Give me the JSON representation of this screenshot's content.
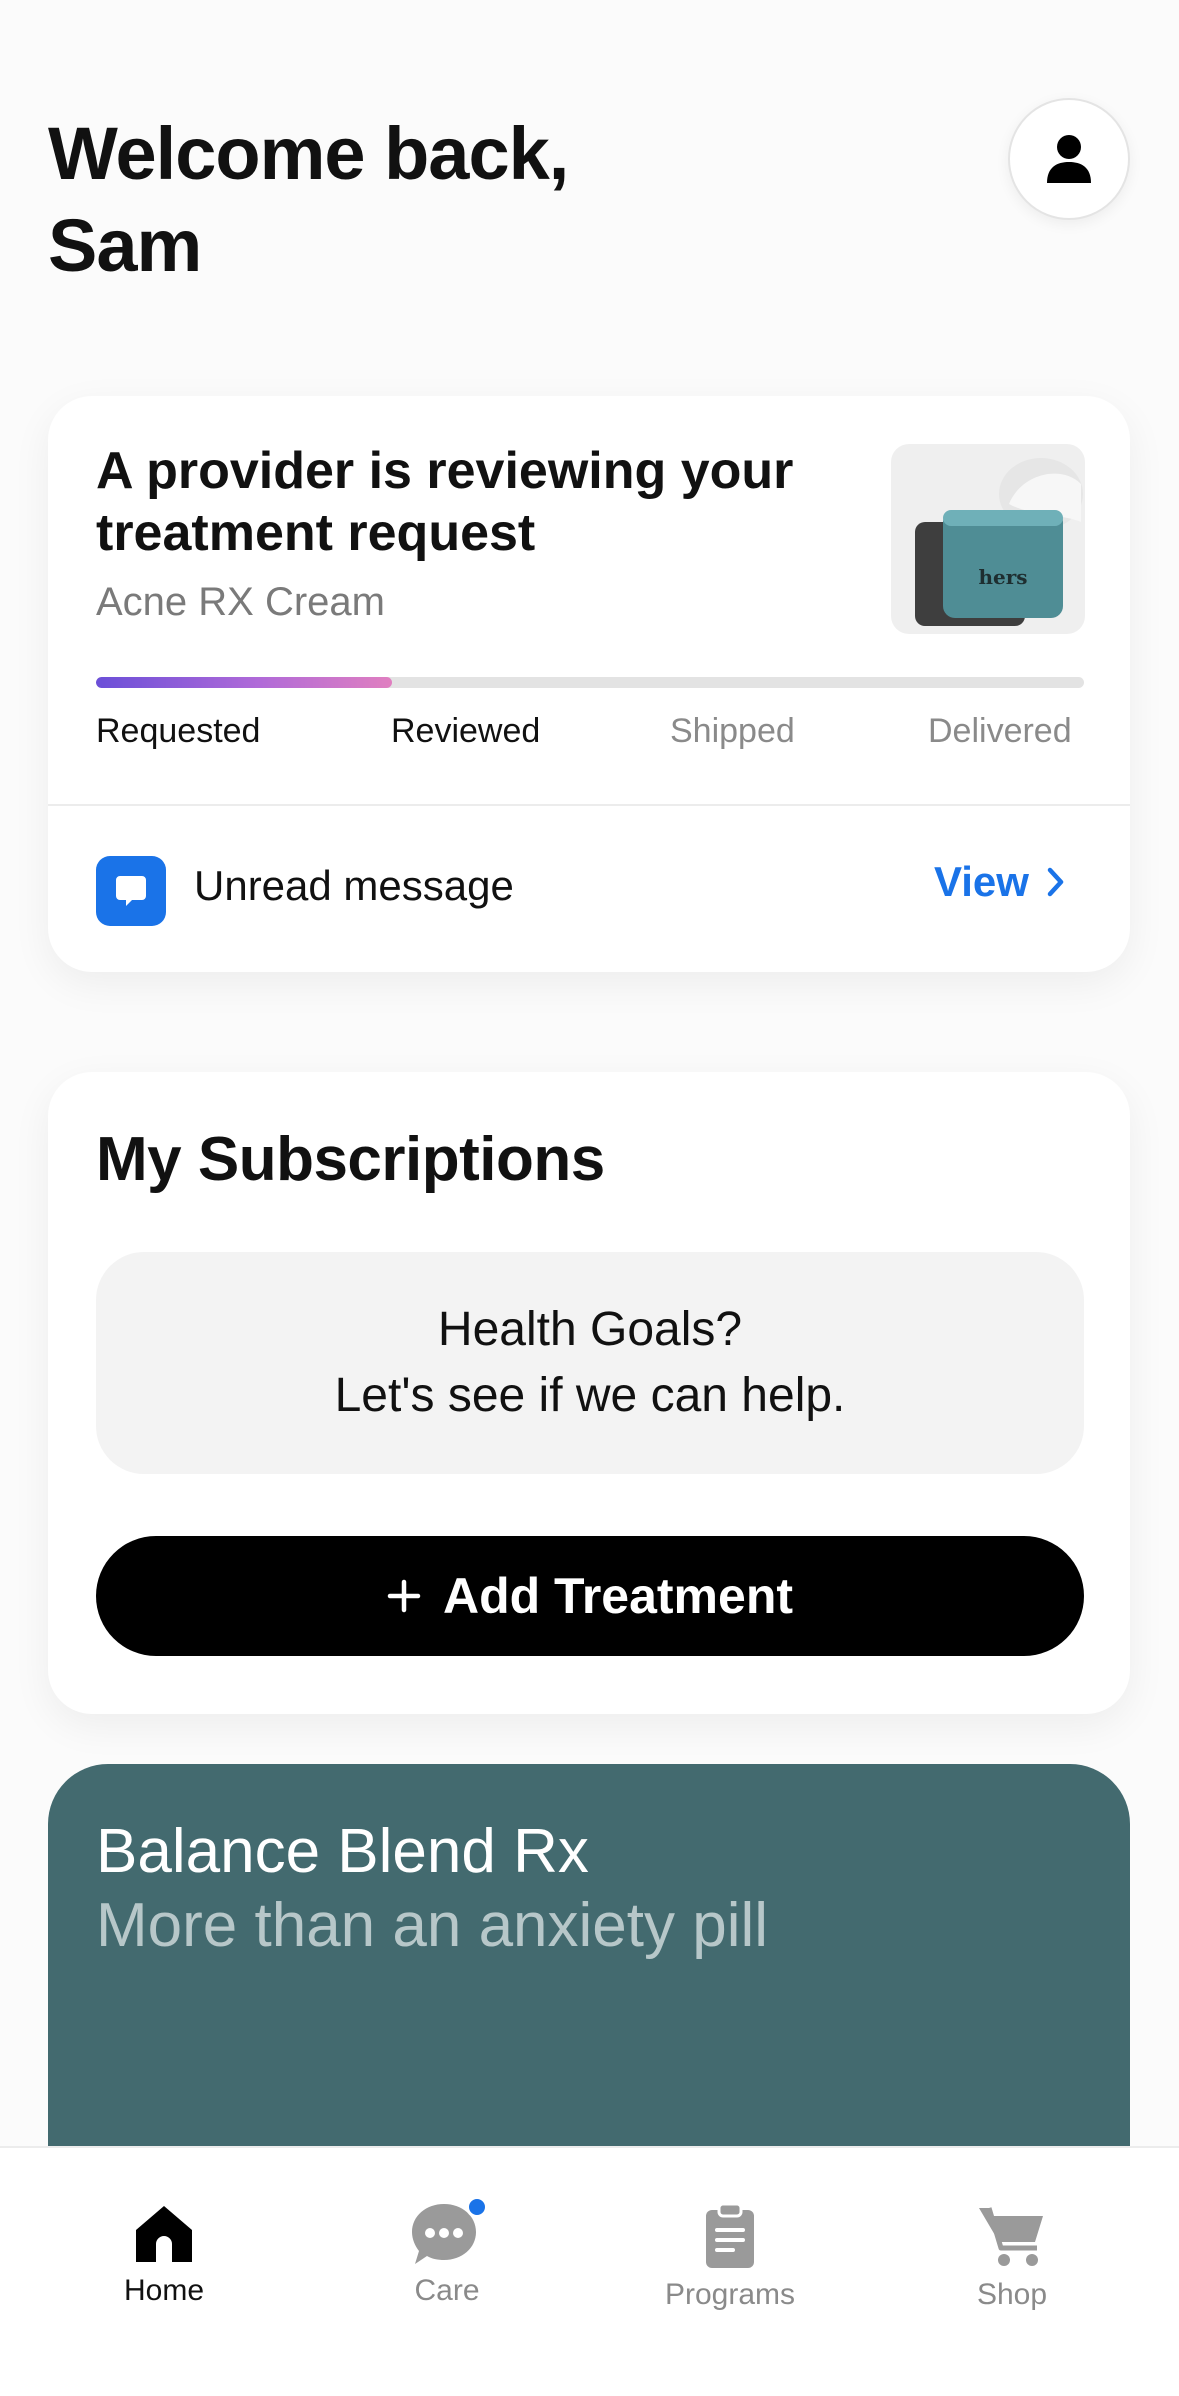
{
  "header": {
    "greeting_line1": "Welcome back,",
    "greeting_line2": "Sam"
  },
  "status_card": {
    "title": "A provider is reviewing your treatment request",
    "product": "Acne RX Cream",
    "product_image_brand": "hers",
    "progress_percent": 30,
    "steps": [
      {
        "label": "Requested",
        "done": true
      },
      {
        "label": "Reviewed",
        "done": true
      },
      {
        "label": "Shipped",
        "done": false
      },
      {
        "label": "Delivered",
        "done": false
      }
    ],
    "message": {
      "label": "Unread message",
      "action": "View"
    }
  },
  "subscriptions": {
    "title": "My Subscriptions",
    "goals_line1": "Health Goals?",
    "goals_line2": "Let's see if we can help.",
    "add_button": "Add Treatment"
  },
  "promo": {
    "title": "Balance Blend Rx",
    "subtitle": "More than an anxiety pill"
  },
  "nav": {
    "items": [
      {
        "label": "Home",
        "icon": "home-icon",
        "active": true
      },
      {
        "label": "Care",
        "icon": "chat-icon",
        "active": false,
        "badge": true
      },
      {
        "label": "Programs",
        "icon": "clipboard-icon",
        "active": false
      },
      {
        "label": "Shop",
        "icon": "cart-icon",
        "active": false
      }
    ]
  },
  "colors": {
    "accent": "#1a73e8",
    "progress_start": "#6b4fd8",
    "progress_end": "#e07fc0",
    "promo_bg": "#436a6f",
    "button_bg": "#000000"
  }
}
